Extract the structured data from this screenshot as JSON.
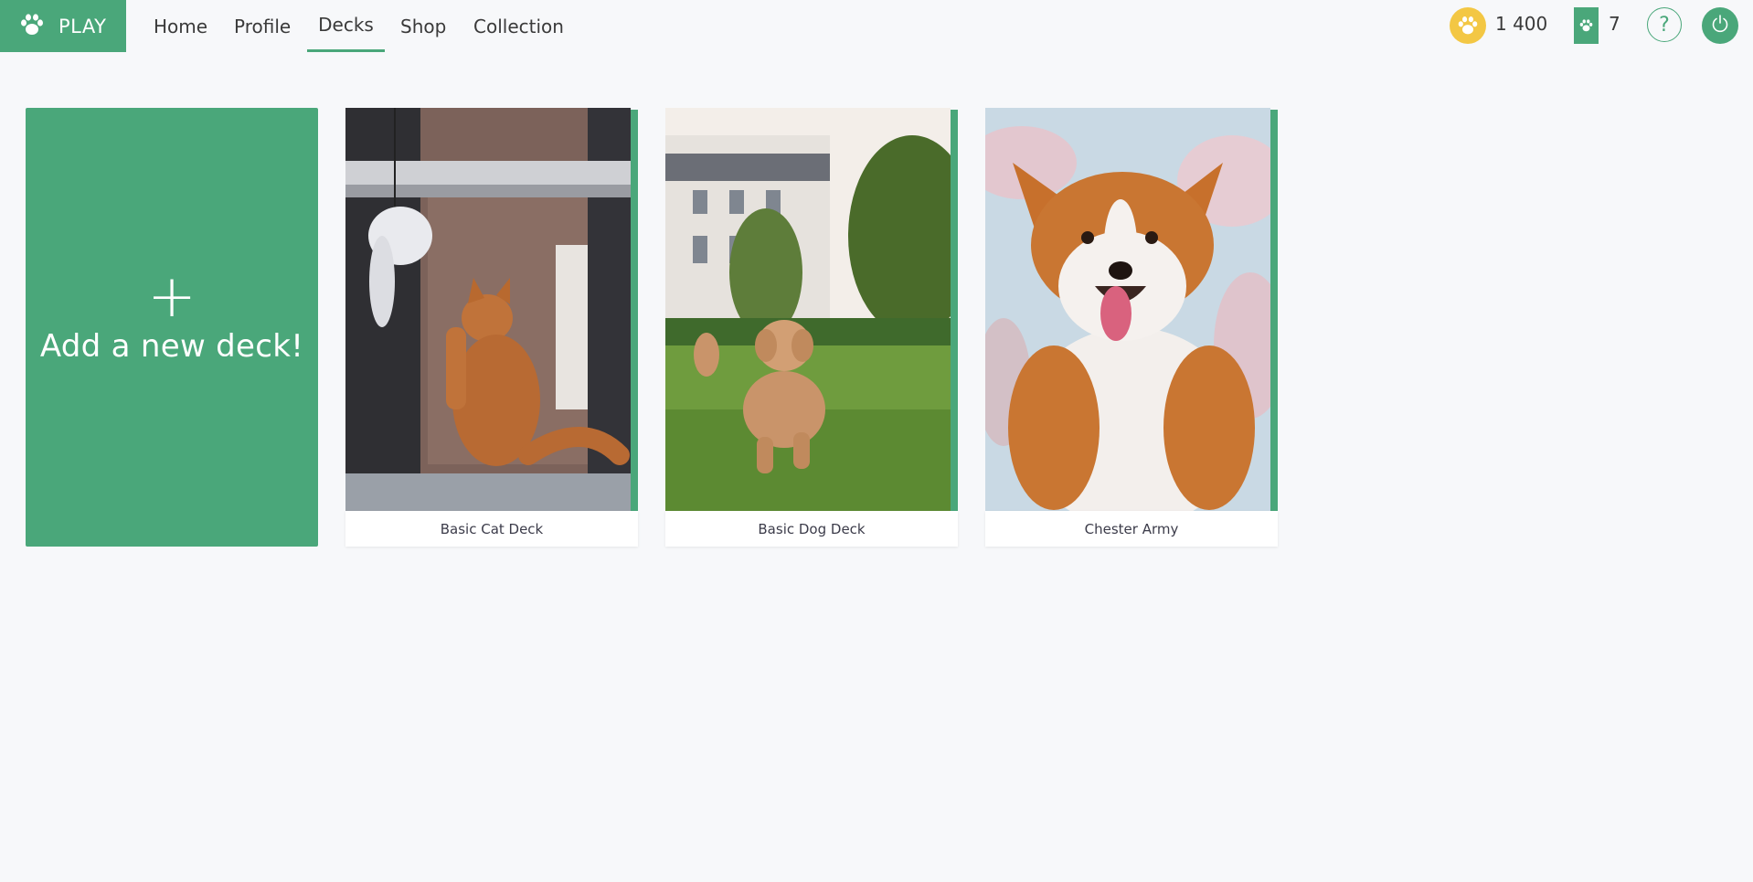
{
  "nav": {
    "play_label": "PLAY",
    "items": [
      {
        "label": "Home"
      },
      {
        "label": "Profile"
      },
      {
        "label": "Decks",
        "active": true
      },
      {
        "label": "Shop"
      },
      {
        "label": "Collection"
      }
    ]
  },
  "status": {
    "coins": "1 400",
    "packs": "7",
    "help_label": "?"
  },
  "add_deck": {
    "plus": "+",
    "label": "Add a new deck!"
  },
  "decks": [
    {
      "name": "Basic Cat Deck",
      "image": "orange-kitten-photo"
    },
    {
      "name": "Basic Dog Deck",
      "image": "running-poodle-photo"
    },
    {
      "name": "Chester Army",
      "image": "corgi-portrait-photo"
    }
  ],
  "colors": {
    "accent": "#4aa77a",
    "coin": "#f3c744",
    "background": "#f7f8fa"
  },
  "icons": [
    "paw-icon",
    "coin-paw-icon",
    "pack-paw-icon",
    "help-icon",
    "power-icon"
  ]
}
